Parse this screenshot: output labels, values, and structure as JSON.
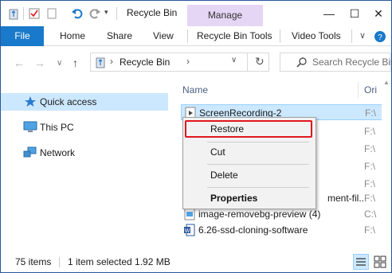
{
  "window": {
    "title": "Recycle Bin",
    "manage_label": "Manage",
    "minimize": "—",
    "maximize": "☐",
    "close": "✕"
  },
  "quick_access_toolbar": {
    "icons": [
      "properties-icon",
      "new-folder-icon",
      "undo-icon",
      "redo-icon",
      "customize-dropdown-icon"
    ]
  },
  "ribbon": {
    "file": "File",
    "tabs": [
      "Home",
      "Share",
      "View"
    ],
    "context_tab": "Recycle Bin Tools",
    "video_tab": "Video Tools",
    "expand_icon": "chevron-down-icon",
    "help_icon": "help-icon"
  },
  "navigation": {
    "back": "←",
    "forward": "→",
    "recent": "∨",
    "up": "↑"
  },
  "address_bar": {
    "location": "Recycle Bin",
    "separator": "›",
    "dropdown": "∨",
    "refresh": "↻"
  },
  "search": {
    "placeholder": "Search Recycle Bin"
  },
  "nav_pane": {
    "items": [
      {
        "label": "Quick access",
        "icon": "star-icon",
        "selected": true
      },
      {
        "label": "This PC",
        "icon": "computer-icon",
        "selected": false
      },
      {
        "label": "Network",
        "icon": "network-icon",
        "selected": false
      }
    ]
  },
  "file_list": {
    "columns": {
      "name": "Name",
      "original_location": "Ori"
    },
    "rows": [
      {
        "name": "ScreenRecording-2",
        "orig": "F:\\",
        "selected": true,
        "icon": "video-file-icon"
      },
      {
        "name": "",
        "orig": "F:\\",
        "selected": false,
        "icon": "file-icon"
      },
      {
        "name": "",
        "orig": "F:\\",
        "selected": false,
        "icon": "file-icon"
      },
      {
        "name": "",
        "orig": "F:\\",
        "selected": false,
        "icon": "file-icon"
      },
      {
        "name": "",
        "orig": "F:\\",
        "selected": false,
        "icon": "file-icon"
      },
      {
        "name": "ment-fil...",
        "orig": "F:\\",
        "selected": false,
        "icon": "file-icon"
      },
      {
        "name": "image-removebg-preview (4)",
        "orig": "C:\\",
        "selected": false,
        "icon": "image-file-icon"
      },
      {
        "name": "6.26-ssd-cloning-software",
        "orig": "F:\\",
        "selected": false,
        "icon": "word-file-icon"
      }
    ]
  },
  "context_menu": {
    "restore": "Restore",
    "cut": "Cut",
    "delete": "Delete",
    "properties": "Properties"
  },
  "status_bar": {
    "item_count": "75 items",
    "selection": "1 item selected  1.92 MB",
    "details_view_icon": "details-view-icon",
    "large_icons_view_icon": "large-icons-view-icon"
  },
  "colors": {
    "accent": "#1979ca",
    "selection": "#cce8ff",
    "manage_tab": "#e6d6f5",
    "highlight_border": "#e0161d"
  }
}
